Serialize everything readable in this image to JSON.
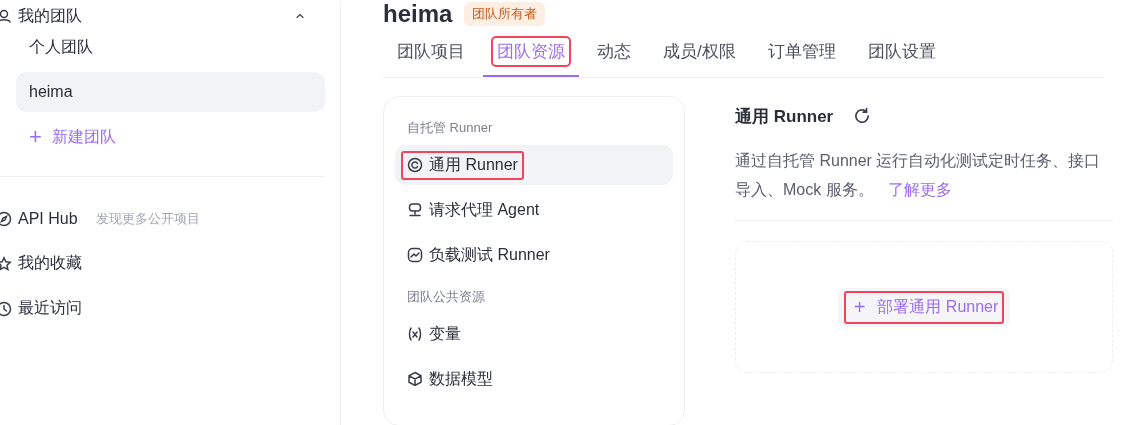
{
  "sidebar": {
    "section_title": "我的团队",
    "teams": [
      {
        "label": "个人团队",
        "selected": false
      },
      {
        "label": "heima",
        "selected": true
      }
    ],
    "new_team": {
      "icon": "+",
      "label": "新建团队"
    },
    "links": [
      {
        "kind": "hub",
        "label": "API Hub",
        "hint": "发现更多公开项目"
      },
      {
        "kind": "star",
        "label": "我的收藏"
      },
      {
        "kind": "clock",
        "label": "最近访问"
      }
    ]
  },
  "header": {
    "title": "heima",
    "badge": "团队所有者"
  },
  "tabs": [
    {
      "label": "团队项目",
      "selected": false,
      "highlighted": false
    },
    {
      "label": "团队资源",
      "selected": true,
      "highlighted": true
    },
    {
      "label": "动态",
      "selected": false,
      "highlighted": false
    },
    {
      "label": "成员/权限",
      "selected": false,
      "highlighted": false
    },
    {
      "label": "订单管理",
      "selected": false,
      "highlighted": false
    },
    {
      "label": "团队设置",
      "selected": false,
      "highlighted": false
    }
  ],
  "resources": [
    {
      "kind": "heading",
      "label": "自托管 Runner"
    },
    {
      "kind": "runner",
      "label": "通用 Runner",
      "selected": true,
      "highlighted": true
    },
    {
      "kind": "agent",
      "label": "请求代理 Agent",
      "selected": false,
      "highlighted": false
    },
    {
      "kind": "chart",
      "label": "负载测试 Runner",
      "selected": false,
      "highlighted": false
    },
    {
      "kind": "heading",
      "label": "团队公共资源"
    },
    {
      "kind": "variable",
      "label": "变量",
      "selected": false,
      "highlighted": false
    },
    {
      "kind": "cube",
      "label": "数据模型",
      "selected": false,
      "highlighted": false
    }
  ],
  "detail": {
    "title": "通用 Runner",
    "description": "通过自托管 Runner 运行自动化测试定时任务、接口导入、Mock 服务。",
    "link": "了解更多",
    "deploy_button": {
      "icon": "+",
      "label": "部署通用 Runner",
      "highlighted": true
    }
  }
}
